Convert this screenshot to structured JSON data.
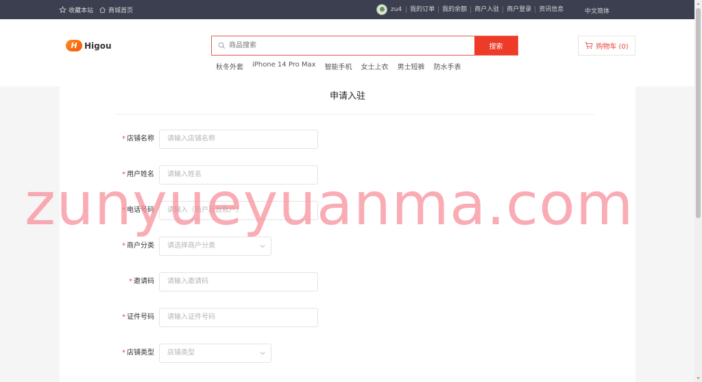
{
  "topbar": {
    "favorite": "收藏本站",
    "home": "商城首页",
    "username": "zu4",
    "links": [
      "我的订单",
      "我的余额",
      "商户入驻",
      "商户登录",
      "资讯信息"
    ],
    "language": "中文简体"
  },
  "header": {
    "logo_mark": "H",
    "logo_text": "Higou",
    "search_placeholder": "商品搜索",
    "search_button": "搜索",
    "hot_keywords": [
      "秋冬外套",
      "iPhone 14 Pro Max",
      "智能手机",
      "女士上衣",
      "男士短裤",
      "防水手表"
    ],
    "cart_label": "购物车 (0)"
  },
  "page": {
    "title": "申请入驻",
    "fields": [
      {
        "label": "店铺名称",
        "placeholder": "请输入店铺名称",
        "type": "input"
      },
      {
        "label": "用户姓名",
        "placeholder": "请输入姓名",
        "type": "input"
      },
      {
        "label": "电话号码",
        "placeholder": "请输入（商户后台账户）",
        "type": "input"
      },
      {
        "label": "商户分类",
        "placeholder": "请选择商户分类",
        "type": "select"
      },
      {
        "label": "邀请码",
        "placeholder": "请输入邀请码",
        "type": "input"
      },
      {
        "label": "证件号码",
        "placeholder": "请输入证件号码",
        "type": "input"
      },
      {
        "label": "店铺类型",
        "placeholder": "店铺类型",
        "type": "select"
      }
    ],
    "required_mark": "*"
  },
  "watermark": "zunyueyuanma.com",
  "colors": {
    "accent": "#ee3b28",
    "topbar_bg": "#3b3f4f",
    "watermark": "#f88c98"
  }
}
